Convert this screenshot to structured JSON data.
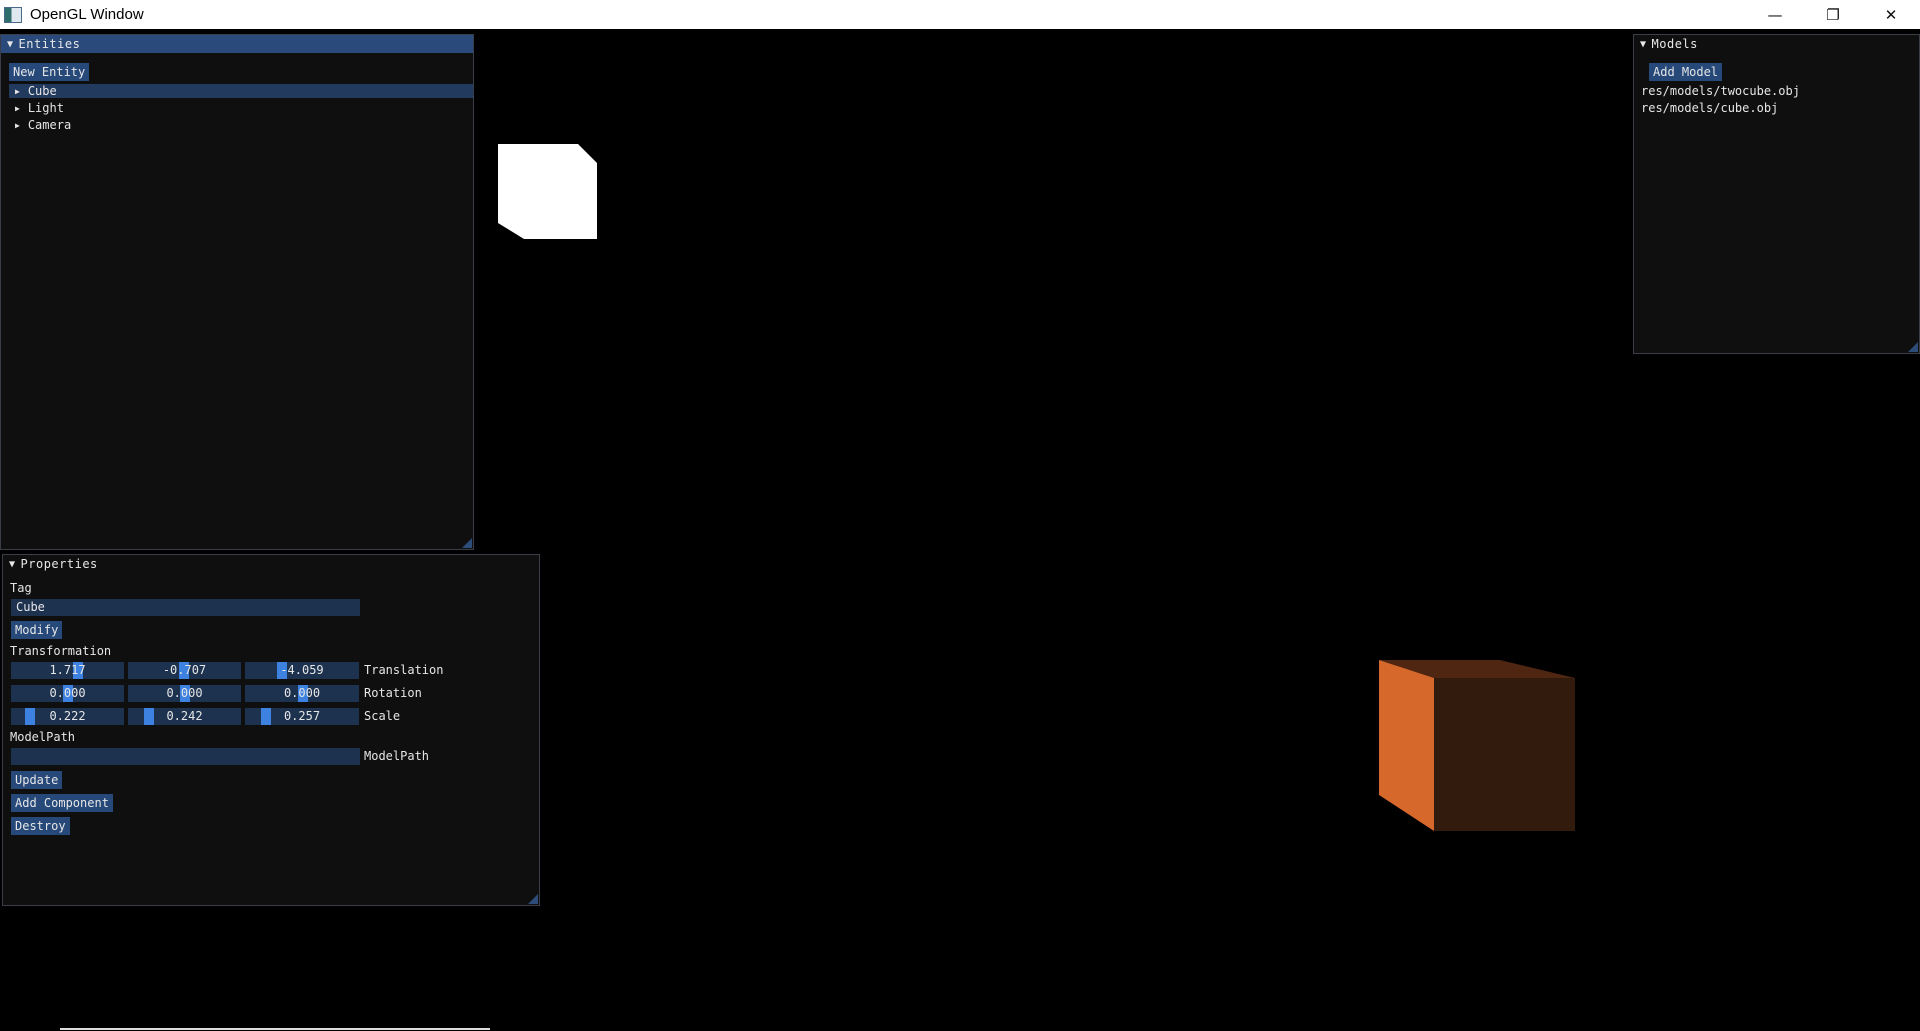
{
  "window": {
    "title": "OpenGL Window",
    "controls": [
      "minimize-icon",
      "restore-icon",
      "close-icon"
    ],
    "control_glyphs": [
      "—",
      "❐",
      "✕"
    ]
  },
  "entities_panel": {
    "title": "Entities",
    "new_entity_label": "New Entity",
    "items": [
      {
        "label": "Cube",
        "selected": true
      },
      {
        "label": "Light",
        "selected": false
      },
      {
        "label": "Camera",
        "selected": false
      }
    ]
  },
  "models_panel": {
    "title": "Models",
    "add_model_label": "Add Model",
    "items": [
      "res/models/twocube.obj",
      "res/models/cube.obj"
    ]
  },
  "properties_panel": {
    "title": "Properties",
    "tag_label": "Tag",
    "tag_value": "Cube",
    "modify_label": "Modify",
    "transformation_label": "Transformation",
    "translation": {
      "label": "Translation",
      "values": [
        "1.717",
        "-0.707",
        "-4.059"
      ]
    },
    "rotation": {
      "label": "Rotation",
      "values": [
        "0.000",
        "0.000",
        "0.000"
      ]
    },
    "scale": {
      "label": "Scale",
      "values": [
        "0.222",
        "0.242",
        "0.257"
      ]
    },
    "modelpath_section_label": "ModelPath",
    "modelpath_value": "",
    "modelpath_field_label": "ModelPath",
    "update_label": "Update",
    "add_component_label": "Add Component",
    "destroy_label": "Destroy"
  },
  "colors": {
    "panel_bg": "#0f0f10",
    "title_active": "#294a7a",
    "button": "#26497a",
    "field": "#1d324f",
    "slider_grab": "#3d82e0",
    "cube_front": "#321a0d",
    "cube_side": "#d7682c",
    "cube_top": "#4e2612",
    "light_cube": "#ffffff"
  }
}
